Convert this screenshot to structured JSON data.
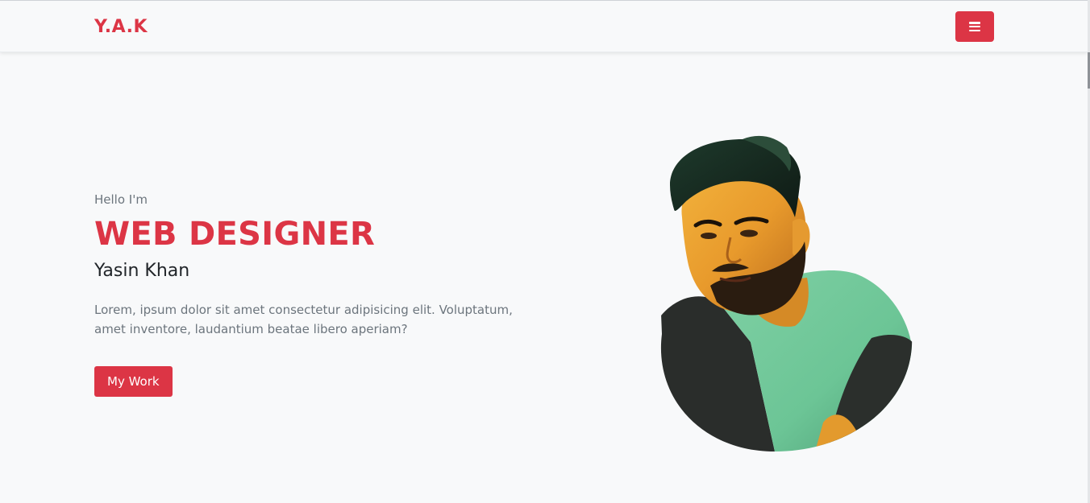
{
  "theme": {
    "accent": "#dc3545",
    "background": "#f8f9fa",
    "text_dark": "#212529",
    "text_muted": "#6c757d"
  },
  "navbar": {
    "brand": "Y.A.K",
    "menu_icon": "hamburger-menu-icon"
  },
  "hero": {
    "greeting": "Hello I'm",
    "headline": "WEB DESIGNER",
    "name": "Yasin Khan",
    "description": "Lorem, ipsum dolor sit amet consectetur adipisicing elit. Voluptatum, amet inventore, laudantium beatae libero aperiam?",
    "button_label": "My Work",
    "portrait_alt": "portrait-photo"
  }
}
